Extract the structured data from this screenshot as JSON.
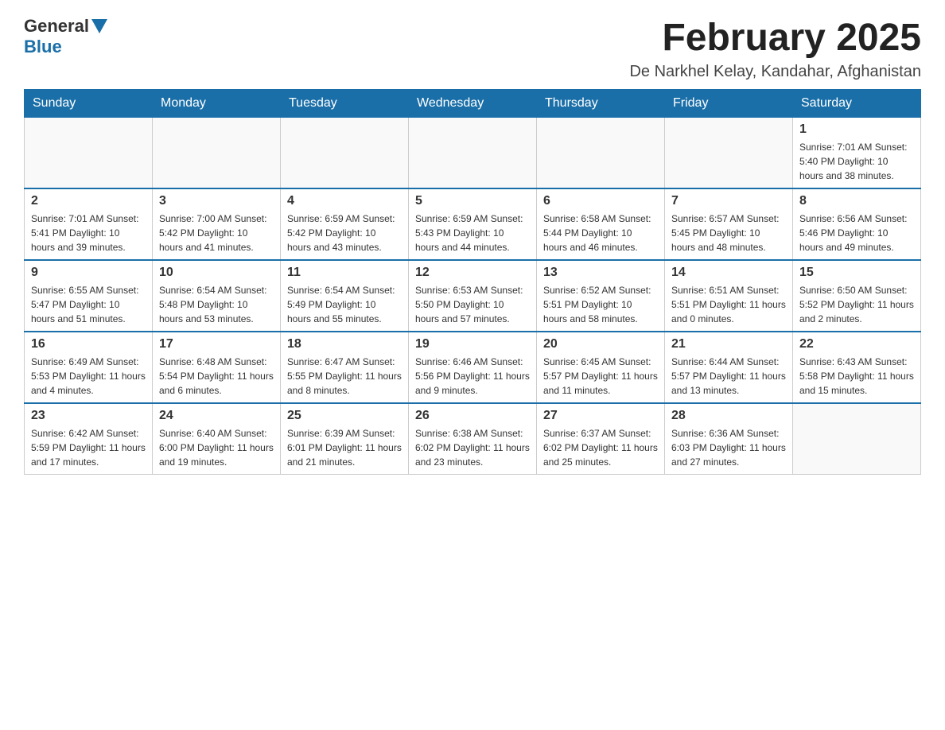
{
  "header": {
    "logo": {
      "general": "General",
      "blue": "Blue"
    },
    "title": "February 2025",
    "location": "De Narkhel Kelay, Kandahar, Afghanistan"
  },
  "calendar": {
    "days_of_week": [
      "Sunday",
      "Monday",
      "Tuesday",
      "Wednesday",
      "Thursday",
      "Friday",
      "Saturday"
    ],
    "weeks": [
      [
        {
          "day": "",
          "info": ""
        },
        {
          "day": "",
          "info": ""
        },
        {
          "day": "",
          "info": ""
        },
        {
          "day": "",
          "info": ""
        },
        {
          "day": "",
          "info": ""
        },
        {
          "day": "",
          "info": ""
        },
        {
          "day": "1",
          "info": "Sunrise: 7:01 AM\nSunset: 5:40 PM\nDaylight: 10 hours and 38 minutes."
        }
      ],
      [
        {
          "day": "2",
          "info": "Sunrise: 7:01 AM\nSunset: 5:41 PM\nDaylight: 10 hours and 39 minutes."
        },
        {
          "day": "3",
          "info": "Sunrise: 7:00 AM\nSunset: 5:42 PM\nDaylight: 10 hours and 41 minutes."
        },
        {
          "day": "4",
          "info": "Sunrise: 6:59 AM\nSunset: 5:42 PM\nDaylight: 10 hours and 43 minutes."
        },
        {
          "day": "5",
          "info": "Sunrise: 6:59 AM\nSunset: 5:43 PM\nDaylight: 10 hours and 44 minutes."
        },
        {
          "day": "6",
          "info": "Sunrise: 6:58 AM\nSunset: 5:44 PM\nDaylight: 10 hours and 46 minutes."
        },
        {
          "day": "7",
          "info": "Sunrise: 6:57 AM\nSunset: 5:45 PM\nDaylight: 10 hours and 48 minutes."
        },
        {
          "day": "8",
          "info": "Sunrise: 6:56 AM\nSunset: 5:46 PM\nDaylight: 10 hours and 49 minutes."
        }
      ],
      [
        {
          "day": "9",
          "info": "Sunrise: 6:55 AM\nSunset: 5:47 PM\nDaylight: 10 hours and 51 minutes."
        },
        {
          "day": "10",
          "info": "Sunrise: 6:54 AM\nSunset: 5:48 PM\nDaylight: 10 hours and 53 minutes."
        },
        {
          "day": "11",
          "info": "Sunrise: 6:54 AM\nSunset: 5:49 PM\nDaylight: 10 hours and 55 minutes."
        },
        {
          "day": "12",
          "info": "Sunrise: 6:53 AM\nSunset: 5:50 PM\nDaylight: 10 hours and 57 minutes."
        },
        {
          "day": "13",
          "info": "Sunrise: 6:52 AM\nSunset: 5:51 PM\nDaylight: 10 hours and 58 minutes."
        },
        {
          "day": "14",
          "info": "Sunrise: 6:51 AM\nSunset: 5:51 PM\nDaylight: 11 hours and 0 minutes."
        },
        {
          "day": "15",
          "info": "Sunrise: 6:50 AM\nSunset: 5:52 PM\nDaylight: 11 hours and 2 minutes."
        }
      ],
      [
        {
          "day": "16",
          "info": "Sunrise: 6:49 AM\nSunset: 5:53 PM\nDaylight: 11 hours and 4 minutes."
        },
        {
          "day": "17",
          "info": "Sunrise: 6:48 AM\nSunset: 5:54 PM\nDaylight: 11 hours and 6 minutes."
        },
        {
          "day": "18",
          "info": "Sunrise: 6:47 AM\nSunset: 5:55 PM\nDaylight: 11 hours and 8 minutes."
        },
        {
          "day": "19",
          "info": "Sunrise: 6:46 AM\nSunset: 5:56 PM\nDaylight: 11 hours and 9 minutes."
        },
        {
          "day": "20",
          "info": "Sunrise: 6:45 AM\nSunset: 5:57 PM\nDaylight: 11 hours and 11 minutes."
        },
        {
          "day": "21",
          "info": "Sunrise: 6:44 AM\nSunset: 5:57 PM\nDaylight: 11 hours and 13 minutes."
        },
        {
          "day": "22",
          "info": "Sunrise: 6:43 AM\nSunset: 5:58 PM\nDaylight: 11 hours and 15 minutes."
        }
      ],
      [
        {
          "day": "23",
          "info": "Sunrise: 6:42 AM\nSunset: 5:59 PM\nDaylight: 11 hours and 17 minutes."
        },
        {
          "day": "24",
          "info": "Sunrise: 6:40 AM\nSunset: 6:00 PM\nDaylight: 11 hours and 19 minutes."
        },
        {
          "day": "25",
          "info": "Sunrise: 6:39 AM\nSunset: 6:01 PM\nDaylight: 11 hours and 21 minutes."
        },
        {
          "day": "26",
          "info": "Sunrise: 6:38 AM\nSunset: 6:02 PM\nDaylight: 11 hours and 23 minutes."
        },
        {
          "day": "27",
          "info": "Sunrise: 6:37 AM\nSunset: 6:02 PM\nDaylight: 11 hours and 25 minutes."
        },
        {
          "day": "28",
          "info": "Sunrise: 6:36 AM\nSunset: 6:03 PM\nDaylight: 11 hours and 27 minutes."
        },
        {
          "day": "",
          "info": ""
        }
      ]
    ]
  }
}
